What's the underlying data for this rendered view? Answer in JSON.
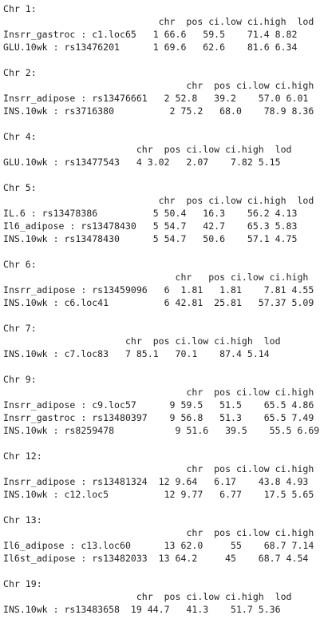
{
  "console": {
    "lines": [
      "Chr 1:",
      "                            chr  pos ci.low ci.high  lod",
      "Insrr_gastroc : c1.loc65   1 66.6   59.5    71.4 8.82",
      "GLU.10wk : rs13476201      1 69.6   62.6    81.6 6.34",
      "",
      "Chr 2:",
      "                                 chr  pos ci.low ci.high  lod",
      "Insrr_adipose : rs13476661   2 52.8   39.2    57.0 6.01",
      "INS.10wk : rs3716380          2 75.2   68.0    78.9 8.36",
      "",
      "Chr 4:",
      "                        chr  pos ci.low ci.high  lod",
      "GLU.10wk : rs13477543   4 3.02   2.07    7.82 5.15",
      "",
      "Chr 5:",
      "                            chr  pos ci.low ci.high  lod",
      "IL.6 : rs13478386          5 50.4   16.3    56.2 4.13",
      "Il6_adipose : rs13478430   5 54.7   42.7    65.3 5.83",
      "INS.10wk : rs13478430      5 54.7   50.6    57.1 4.75",
      "",
      "Chr 6:",
      "                               chr   pos ci.low ci.high  lod",
      "Insrr_adipose : rs13459096   6  1.81   1.81    7.81 4.55",
      "INS.10wk : c6.loc41          6 42.81  25.81   57.37 5.09",
      "",
      "Chr 7:",
      "                      chr  pos ci.low ci.high  lod",
      "INS.10wk : c7.loc83   7 85.1   70.1    87.4 5.14",
      "",
      "Chr 9:",
      "                                 chr  pos ci.low ci.high  lod",
      "Insrr_adipose : c9.loc57      9 59.5   51.5    65.5 4.86",
      "Insrr_gastroc : rs13480397    9 56.8   51.3    65.5 7.49",
      "INS.10wk : rs8259478           9 51.6   39.5    55.5 6.69",
      "",
      "Chr 12:",
      "                                 chr  pos ci.low ci.high  lod",
      "Insrr_adipose : rs13481324  12 9.64   6.17    43.8 4.93",
      "INS.10wk : c12.loc5          12 9.77   6.77    17.5 5.65",
      "",
      "Chr 13:",
      "                                 chr  pos ci.low ci.high  lod",
      "Il6_adipose : c13.loc60      13 62.0     55    68.7 7.14",
      "Il6st_adipose : rs13482033  13 64.2     45    68.7 4.54",
      "",
      "Chr 19:",
      "                        chr  pos ci.low ci.high  lod",
      "INS.10wk : rs13483658  19 44.7   41.3    51.7 5.36"
    ]
  }
}
